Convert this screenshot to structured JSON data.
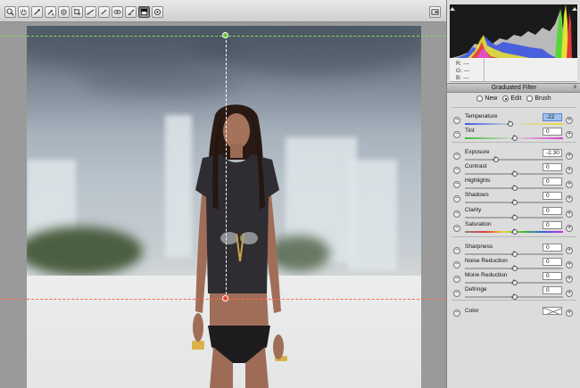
{
  "toolbar": {
    "tools": [
      {
        "name": "zoom-tool",
        "icon": "zoom-icon"
      },
      {
        "name": "hand-tool",
        "icon": "hand-icon"
      },
      {
        "name": "white-balance-tool",
        "icon": "eyedropper-icon"
      },
      {
        "name": "color-sampler-tool",
        "icon": "color-sampler-icon"
      },
      {
        "name": "targeted-adjustment-tool",
        "icon": "target-adjust-icon"
      },
      {
        "name": "crop-tool",
        "icon": "crop-icon"
      },
      {
        "name": "straighten-tool",
        "icon": "straighten-icon"
      },
      {
        "name": "spot-removal-tool",
        "icon": "brush-icon"
      },
      {
        "name": "red-eye-tool",
        "icon": "red-eye-icon"
      },
      {
        "name": "adjustment-brush-tool",
        "icon": "adjustment-brush-icon"
      },
      {
        "name": "graduated-filter-tool",
        "icon": "graduated-filter-icon",
        "active": true
      },
      {
        "name": "radial-filter-tool",
        "icon": "radial-filter-icon"
      }
    ],
    "right_icon": "fullscreen-icon"
  },
  "rgb_readout": {
    "r": "R:   ---",
    "g": "G:   ---",
    "b": "B:   ---"
  },
  "panel": {
    "title": "Graduated Filter",
    "modes": [
      {
        "label": "New",
        "selected": false
      },
      {
        "label": "Edit",
        "selected": true
      },
      {
        "label": "Brush",
        "selected": false
      }
    ],
    "sliders": [
      {
        "label": "Temperature",
        "value": "-22",
        "selected": true,
        "position": 0.45,
        "track": "temperature"
      },
      {
        "label": "Tint",
        "value": "0",
        "position": 0.5,
        "track": "tint"
      },
      {
        "label": "Exposure",
        "value": "-2.30",
        "position": 0.31,
        "track": "gray"
      },
      {
        "label": "Contrast",
        "value": "0",
        "position": 0.5,
        "track": "gray"
      },
      {
        "label": "Highlights",
        "value": "0",
        "position": 0.5,
        "track": "gray"
      },
      {
        "label": "Shadows",
        "value": "0",
        "position": 0.5,
        "track": "gray"
      },
      {
        "label": "Clarity",
        "value": "0",
        "position": 0.5,
        "track": "gray"
      },
      {
        "label": "Saturation",
        "value": "0",
        "position": 0.5,
        "track": "saturation"
      },
      {
        "label": "Sharpness",
        "value": "0",
        "position": 0.5,
        "track": "gray"
      },
      {
        "label": "Noise Reduction",
        "value": "0",
        "position": 0.5,
        "track": "gray"
      },
      {
        "label": "Moire Reduction",
        "value": "0",
        "position": 0.5,
        "track": "gray"
      },
      {
        "label": "Defringe",
        "value": "0",
        "position": 0.5,
        "track": "gray"
      }
    ],
    "color_label": "Color"
  },
  "colors": {
    "guide_green": "#8fd35a",
    "guide_red": "#ff6a4a",
    "pin_green": "#6fc33a",
    "pin_red": "#e8442a",
    "value_highlight": "#9ec3ee"
  }
}
